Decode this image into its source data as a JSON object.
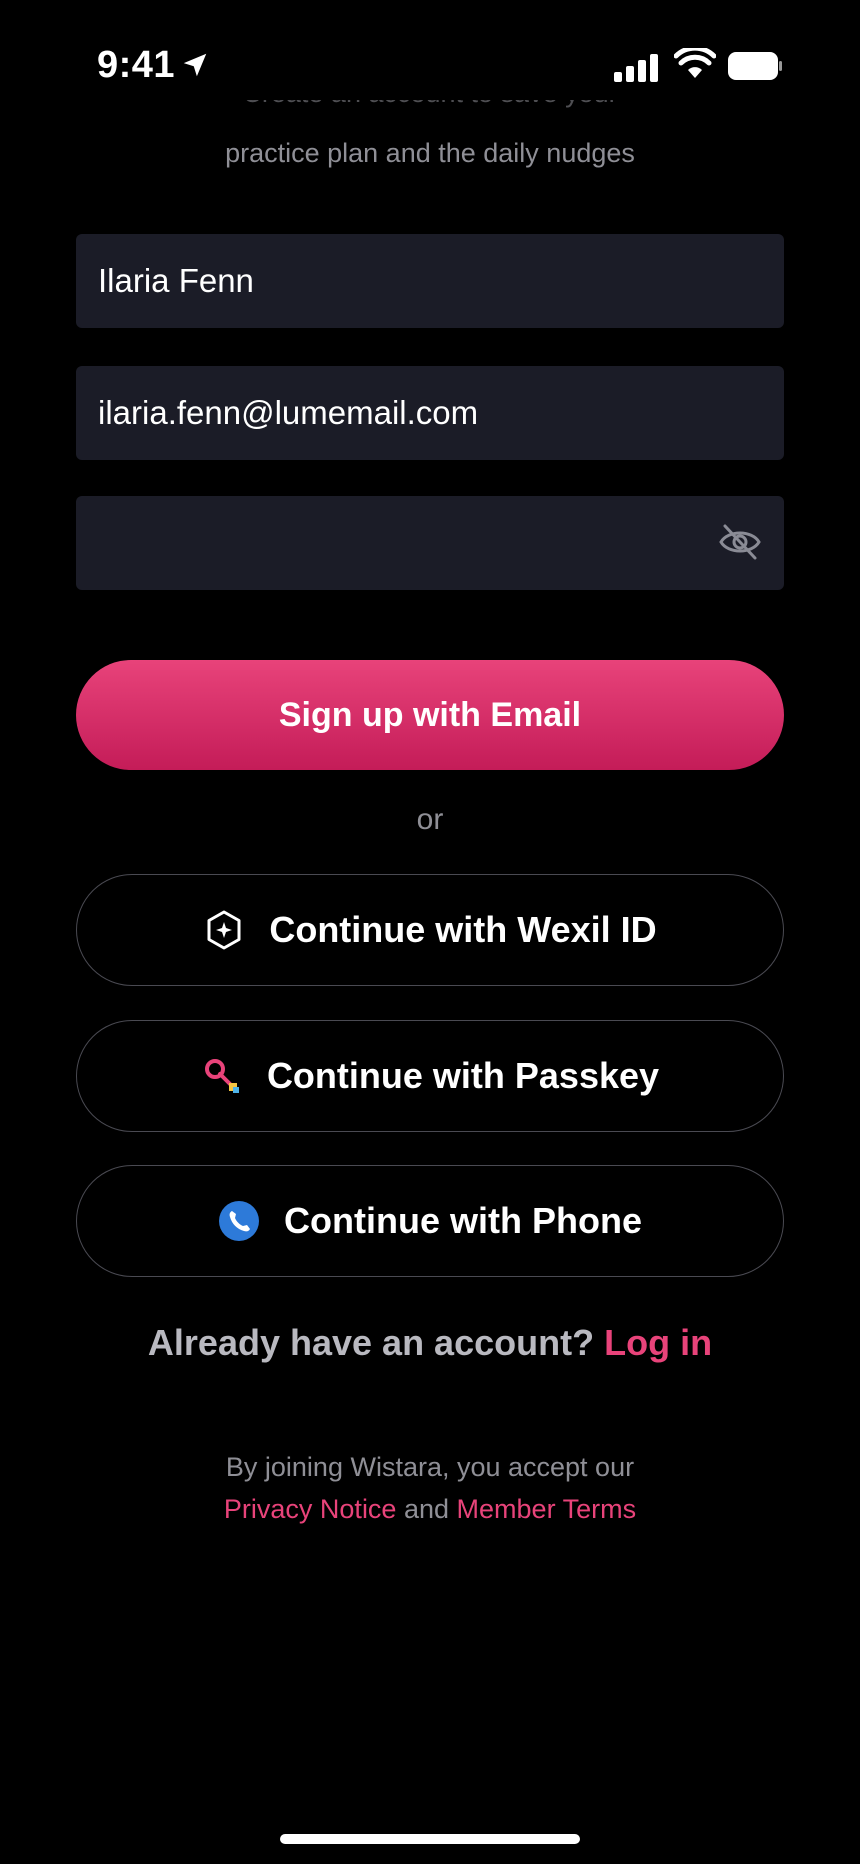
{
  "status_bar": {
    "time": "9:41"
  },
  "intro": {
    "line1": "Create an account to save your",
    "line2": "practice plan and the daily nudges"
  },
  "form": {
    "name_value": "Ilaria Fenn",
    "email_value": "ilaria.fenn@lumemail.com",
    "password_value": ""
  },
  "primary_button": "Sign up with Email",
  "divider_text": "or",
  "alt_buttons": {
    "wexil": "Continue with Wexil ID",
    "passkey": "Continue with Passkey",
    "phone": "Continue with Phone"
  },
  "login": {
    "prompt": "Already have an account?",
    "link": "Log in"
  },
  "legal": {
    "prefix": "By joining Wistara, you accept our",
    "privacy": "Privacy Notice",
    "and": "and",
    "terms": "Member Terms"
  },
  "colors": {
    "accent": "#e8437a",
    "field_bg": "#1b1c27",
    "background": "#000000"
  }
}
